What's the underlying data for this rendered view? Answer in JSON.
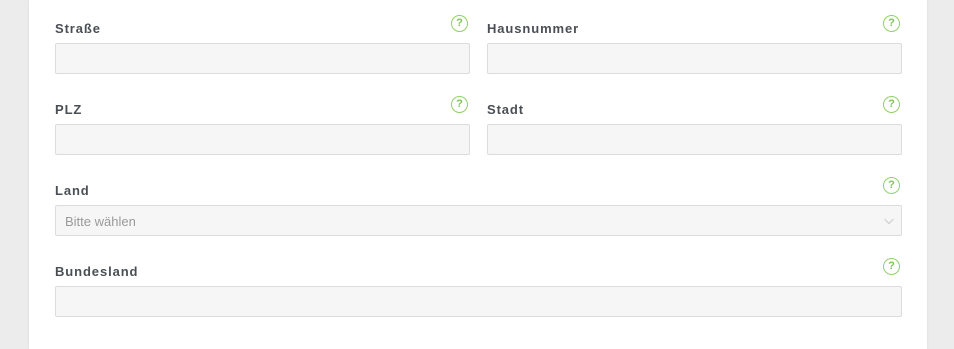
{
  "form": {
    "street": {
      "label": "Straße",
      "value": ""
    },
    "house_number": {
      "label": "Hausnummer",
      "value": ""
    },
    "zip": {
      "label": "PLZ",
      "value": ""
    },
    "city": {
      "label": "Stadt",
      "value": ""
    },
    "country": {
      "label": "Land",
      "selected": "Bitte wählen"
    },
    "state": {
      "label": "Bundesland",
      "value": ""
    },
    "help_glyph": "?"
  },
  "colors": {
    "help_accent": "#8fd16b",
    "label": "#4a4f55",
    "input_bg": "#f6f6f6"
  },
  "icons": {
    "help": "help-circle-icon",
    "dropdown": "chevron-down-icon"
  }
}
